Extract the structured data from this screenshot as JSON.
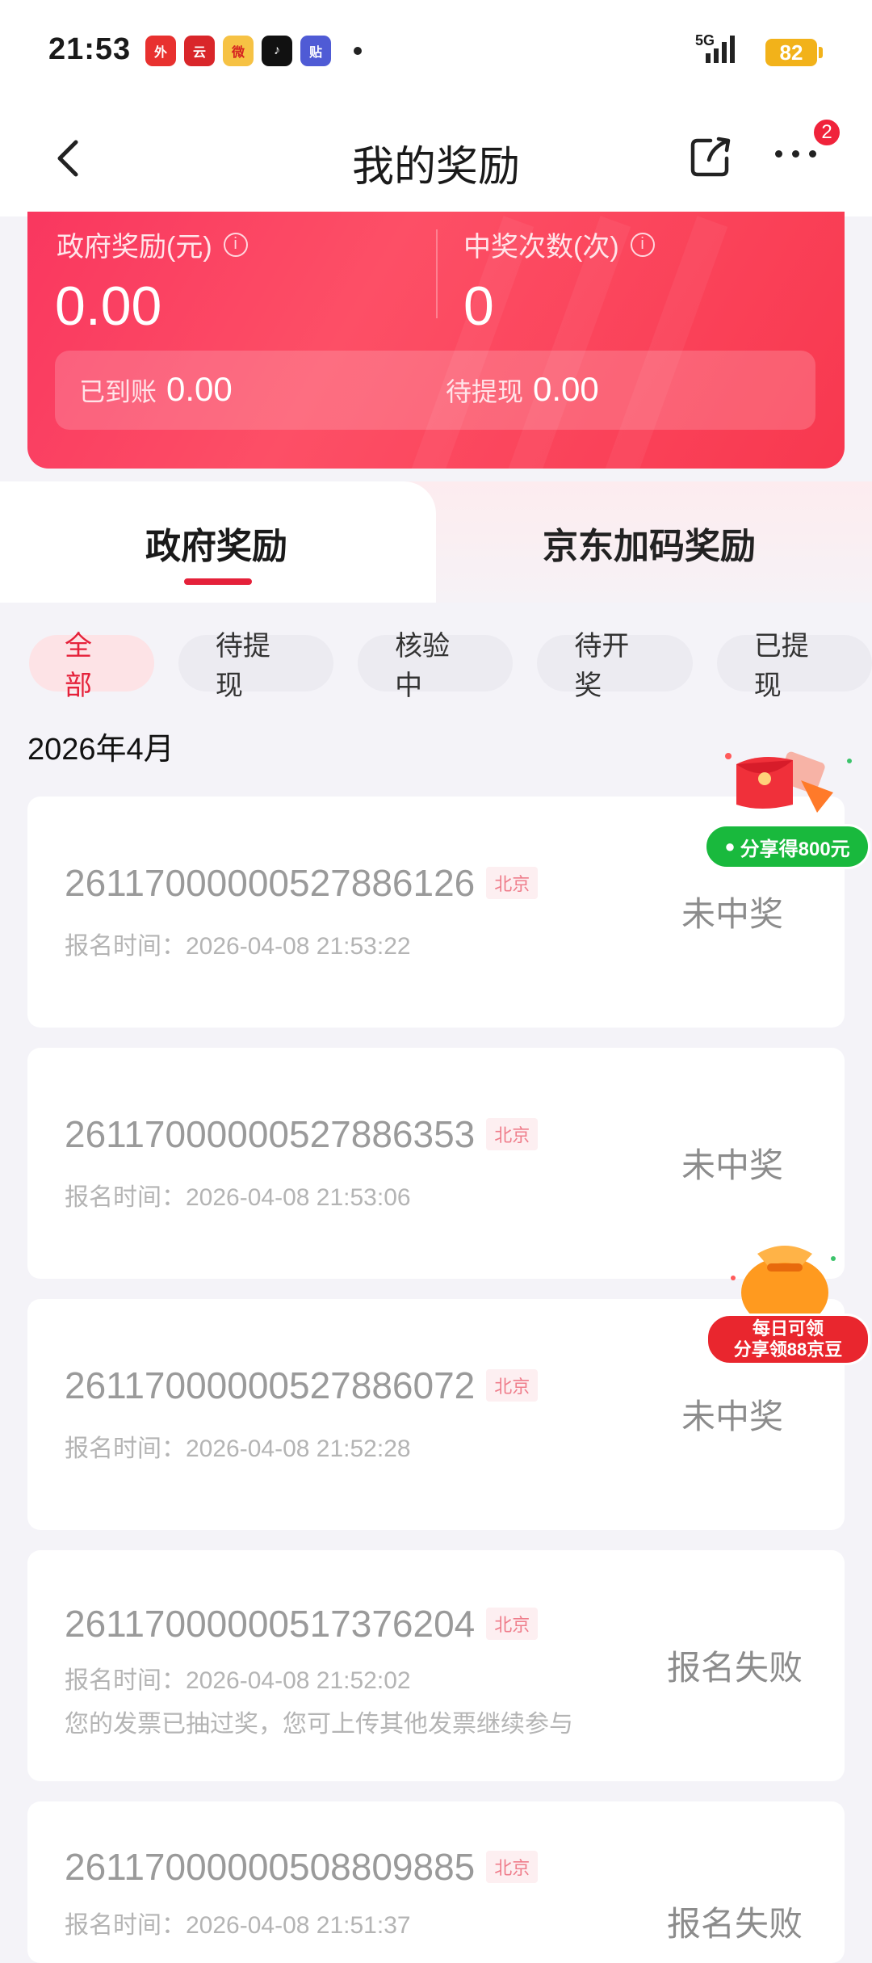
{
  "status_bar": {
    "time": "21:53",
    "network": "5G",
    "battery": "82",
    "app_icons": [
      "jd-takeout-icon",
      "cloud-flash-pay-icon",
      "weibo-icon",
      "tiktok-icon",
      "tieba-icon"
    ]
  },
  "nav": {
    "title": "我的奖励",
    "badge": "2"
  },
  "summary": {
    "gov_label": "政府奖励(元)",
    "gov_value": "0.00",
    "wins_label": "中奖次数(次)",
    "wins_value": "0",
    "credited_label": "已到账",
    "credited_value": "0.00",
    "pending_label": "待提现",
    "pending_value": "0.00"
  },
  "tabs": [
    {
      "label": "政府奖励",
      "active": true
    },
    {
      "label": "京东加码奖励",
      "active": false
    }
  ],
  "filters": [
    {
      "label": "全部",
      "active": true
    },
    {
      "label": "待提现",
      "active": false
    },
    {
      "label": "核验中",
      "active": false
    },
    {
      "label": "待开奖",
      "active": false
    },
    {
      "label": "已提现",
      "active": false
    }
  ],
  "month": "2026年4月",
  "records": [
    {
      "number": "2611700000052788612­6",
      "city": "北京",
      "time": "报名时间：2026-04-08 21:53:22",
      "status": "未中奖",
      "note": ""
    },
    {
      "number": "26117000000527886353",
      "city": "北京",
      "time": "报名时间：2026-04-08 21:53:06",
      "status": "未中奖",
      "note": ""
    },
    {
      "number": "26117000000527886072",
      "city": "北京",
      "time": "报名时间：2026-04-08 21:52:28",
      "status": "未中奖",
      "note": ""
    },
    {
      "number": "26117000000517376204",
      "city": "北京",
      "time": "报名时间：2026-04-08 21:52:02",
      "status": "报名失败",
      "note": "您的发票已抽过奖，您可上传其他发票继续参与"
    },
    {
      "number": "26117000000508809885",
      "city": "北京",
      "time": "报名时间：2026-04-08 21:51:37",
      "status": "报名失败",
      "note": ""
    }
  ],
  "promos": {
    "share": "分享得800元",
    "daily_line1": "每日可领",
    "daily_line2": "分享领88京豆"
  },
  "colors": {
    "accent": "#e5213a",
    "card_red": "#fd4f66",
    "wechat_green": "#19b93d"
  }
}
